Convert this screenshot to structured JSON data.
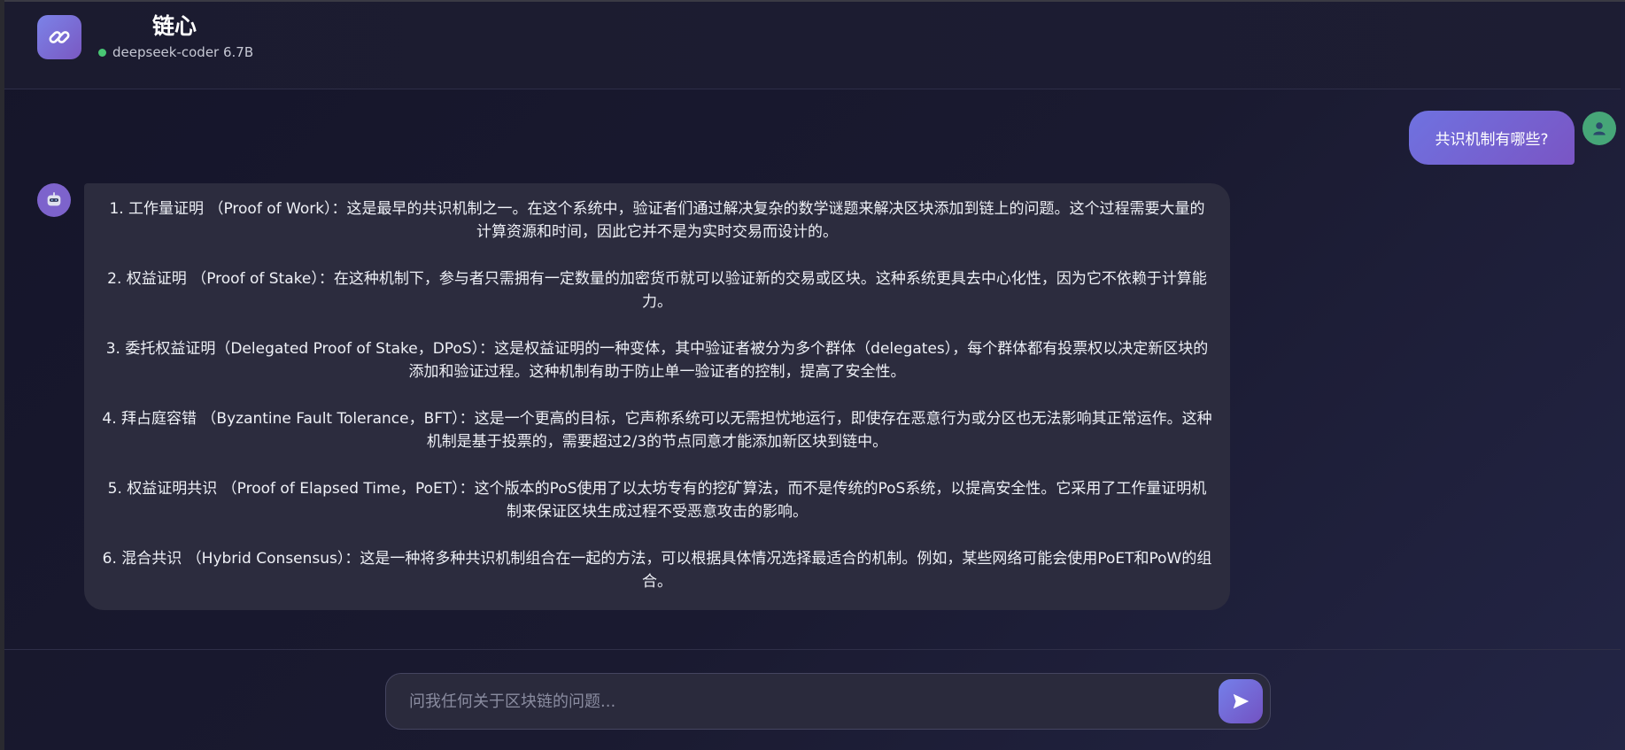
{
  "header": {
    "title": "链心",
    "model_name": "deepseek-coder 6.7B",
    "status_color": "#48c774",
    "logo_icon": "link-icon"
  },
  "messages": [
    {
      "role": "user",
      "text": "共识机制有哪些?",
      "avatar_icon": "user-icon"
    },
    {
      "role": "assistant",
      "avatar_icon": "robot-icon",
      "paragraphs": [
        "1. 工作量证明 （Proof of Work）：这是最早的共识机制之一。在这个系统中，验证者们通过解决复杂的数学谜题来解决区块添加到链上的问题。这个过程需要大量的计算资源和时间，因此它并不是为实时交易而设计的。",
        "2. 权益证明 （Proof of Stake）：在这种机制下，参与者只需拥有一定数量的加密货币就可以验证新的交易或区块。这种系统更具去中心化性，因为它不依赖于计算能力。",
        "3. 委托权益证明（Delegated Proof of Stake，DPoS）：这是权益证明的一种变体，其中验证者被分为多个群体（delegates），每个群体都有投票权以决定新区块的添加和验证过程。这种机制有助于防止单一验证者的控制，提高了安全性。",
        "4. 拜占庭容错 （Byzantine Fault Tolerance，BFT）：这是一个更高的目标，它声称系统可以无需担忧地运行，即使存在恶意行为或分区也无法影响其正常运作。这种机制是基于投票的，需要超过2/3的节点同意才能添加新区块到链中。",
        "5. 权益证明共识 （Proof of Elapsed Time，PoET）：这个版本的PoS使用了以太坊专有的挖矿算法，而不是传统的PoS系统，以提高安全性。它采用了工作量证明机制来保证区块生成过程不受恶意攻击的影响。",
        "6. 混合共识 （Hybrid Consensus）：这是一种将多种共识机制组合在一起的方法，可以根据具体情况选择最适合的机制。例如，某些网络可能会使用PoET和PoW的组合。"
      ]
    }
  ],
  "composer": {
    "placeholder": "问我任何关于区块链的问题...",
    "value": "",
    "send_icon": "send-icon"
  }
}
